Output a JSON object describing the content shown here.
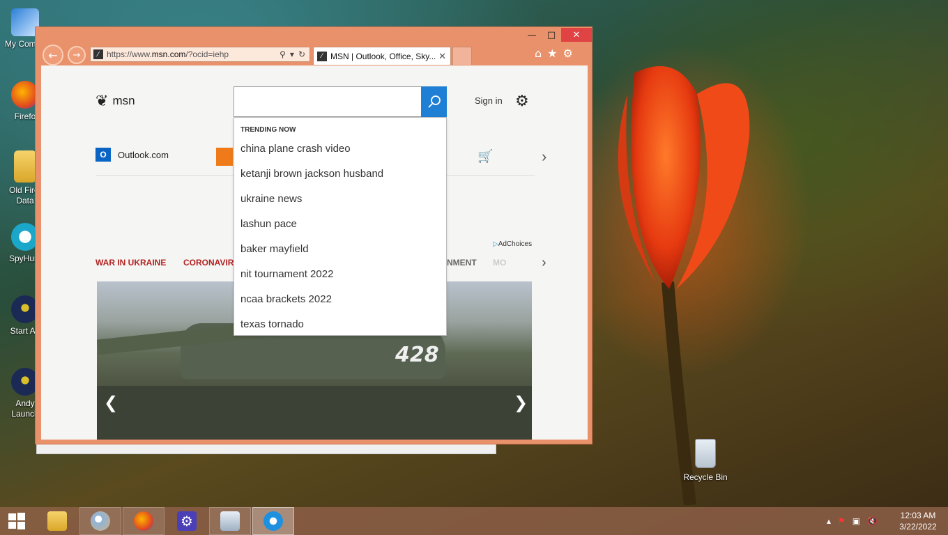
{
  "desktop": {
    "icons": [
      {
        "label": "My Compu"
      },
      {
        "label": "Firefo"
      },
      {
        "label": "Old Firef Data"
      },
      {
        "label": "SpyHunt"
      },
      {
        "label": "Start An"
      },
      {
        "label": "Andy Launch"
      }
    ],
    "recycle_bin": "Recycle Bin"
  },
  "browser": {
    "address": {
      "prefix": "https://www.",
      "domain": "msn.com",
      "path": "/?ocid=iehp"
    },
    "tab": {
      "title": "MSN | Outlook, Office, Sky..."
    },
    "page": {
      "logo_text": "msn",
      "search": {
        "value": "",
        "placeholder": ""
      },
      "sign_in": "Sign in",
      "quicklinks": {
        "outlook": "Outlook.com"
      },
      "adchoices": "AdChoices",
      "nav_categories": {
        "war": "WAR IN UKRAINE",
        "corona": "CORONAVIR",
        "ent": "NMENT",
        "more": "MO"
      },
      "hero_number": "428",
      "suggestions": {
        "header": "TRENDING NOW",
        "items": [
          "china plane crash video",
          "ketanji brown jackson husband",
          "ukraine news",
          "lashun pace",
          "baker mayfield",
          "nit tournament 2022",
          "ncaa brackets 2022",
          "texas tornado"
        ]
      }
    }
  },
  "taskbar": {
    "clock_time": "12:03 AM",
    "clock_date": "3/22/2022"
  }
}
